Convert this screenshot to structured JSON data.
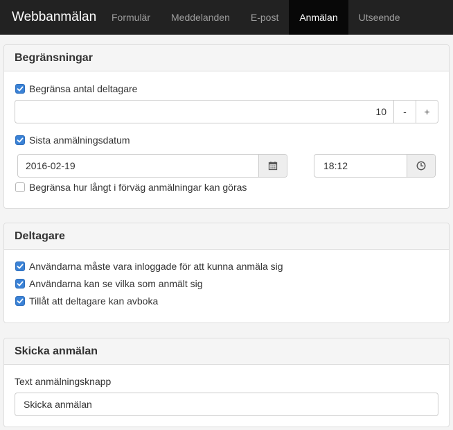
{
  "navbar": {
    "brand": "Webbanmälan",
    "tabs": [
      {
        "label": "Formulär",
        "active": false
      },
      {
        "label": "Meddelanden",
        "active": false
      },
      {
        "label": "E-post",
        "active": false
      },
      {
        "label": "Anmälan",
        "active": true
      },
      {
        "label": "Utseende",
        "active": false
      }
    ]
  },
  "limits": {
    "title": "Begränsningar",
    "limit_participants_label": "Begränsa antal deltagare",
    "limit_participants_checked": true,
    "participant_count": "10",
    "decrement_label": "-",
    "increment_label": "+",
    "deadline_label": "Sista anmälningsdatum",
    "deadline_checked": true,
    "deadline_date": "2016-02-19",
    "deadline_time": "18:12",
    "advance_limit_label": "Begränsa hur långt i förväg anmälningar kan göras",
    "advance_limit_checked": false
  },
  "participants": {
    "title": "Deltagare",
    "options": [
      {
        "label": "Användarna måste vara inloggade för att kunna anmäla sig",
        "checked": true
      },
      {
        "label": "Användarna kan se vilka som anmält sig",
        "checked": true
      },
      {
        "label": "Tillåt att deltagare kan avboka",
        "checked": true
      }
    ]
  },
  "submit": {
    "title": "Skicka anmälan",
    "button_text_label": "Text anmälningsknapp",
    "button_text_value": "Skicka anmälan"
  },
  "icons": {
    "calendar": "calendar-icon",
    "clock": "clock-icon",
    "check": "checkmark-icon"
  },
  "colors": {
    "navbar_bg": "#222222",
    "active_tab_bg": "#080808",
    "checkbox_blue": "#3a82d6"
  }
}
